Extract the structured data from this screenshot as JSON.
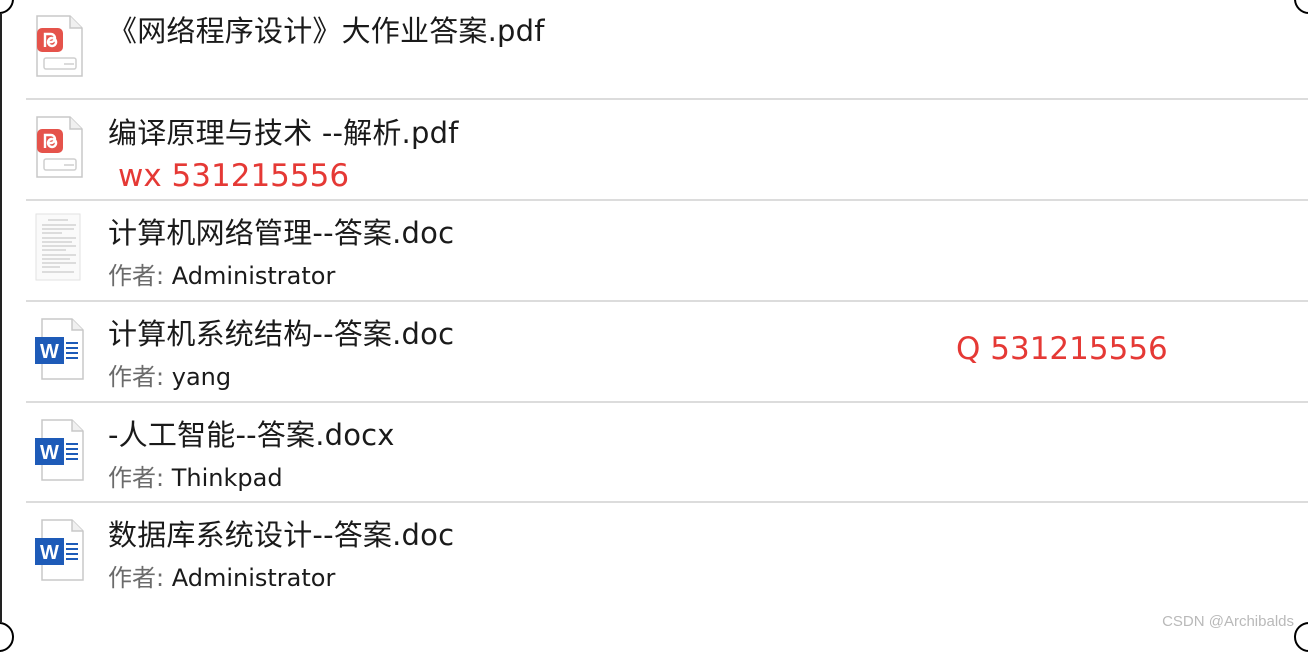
{
  "files": [
    {
      "icon": "pdf-icon",
      "title": "《网络程序设计》大作业答案.pdf",
      "meta_key": "",
      "meta_val": ""
    },
    {
      "icon": "pdf-icon",
      "title": "编译原理与技术 --解析.pdf",
      "meta_key": "",
      "meta_val": ""
    },
    {
      "icon": "doc-thumbnail-icon",
      "title": "计算机网络管理--答案.doc",
      "meta_key": "作者:",
      "meta_val": "Administrator"
    },
    {
      "icon": "word-doc-icon",
      "title": "计算机系统结构--答案.doc",
      "meta_key": "作者:",
      "meta_val": "yang"
    },
    {
      "icon": "word-doc-icon",
      "title": "-人工智能--答案.docx",
      "meta_key": "作者:",
      "meta_val": "Thinkpad"
    },
    {
      "icon": "word-doc-icon",
      "title": "数据库系统设计--答案.doc",
      "meta_key": "作者:",
      "meta_val": "Administrator"
    }
  ],
  "notes": {
    "wx": "wx 531215556",
    "qq": "Q 531215556"
  },
  "watermark": "CSDN @Archibalds",
  "colors": {
    "note_red": "#e53935",
    "pdf_red": "#e5534b",
    "word_blue": "#1e5bb8",
    "separator": "#dcdcdc"
  }
}
